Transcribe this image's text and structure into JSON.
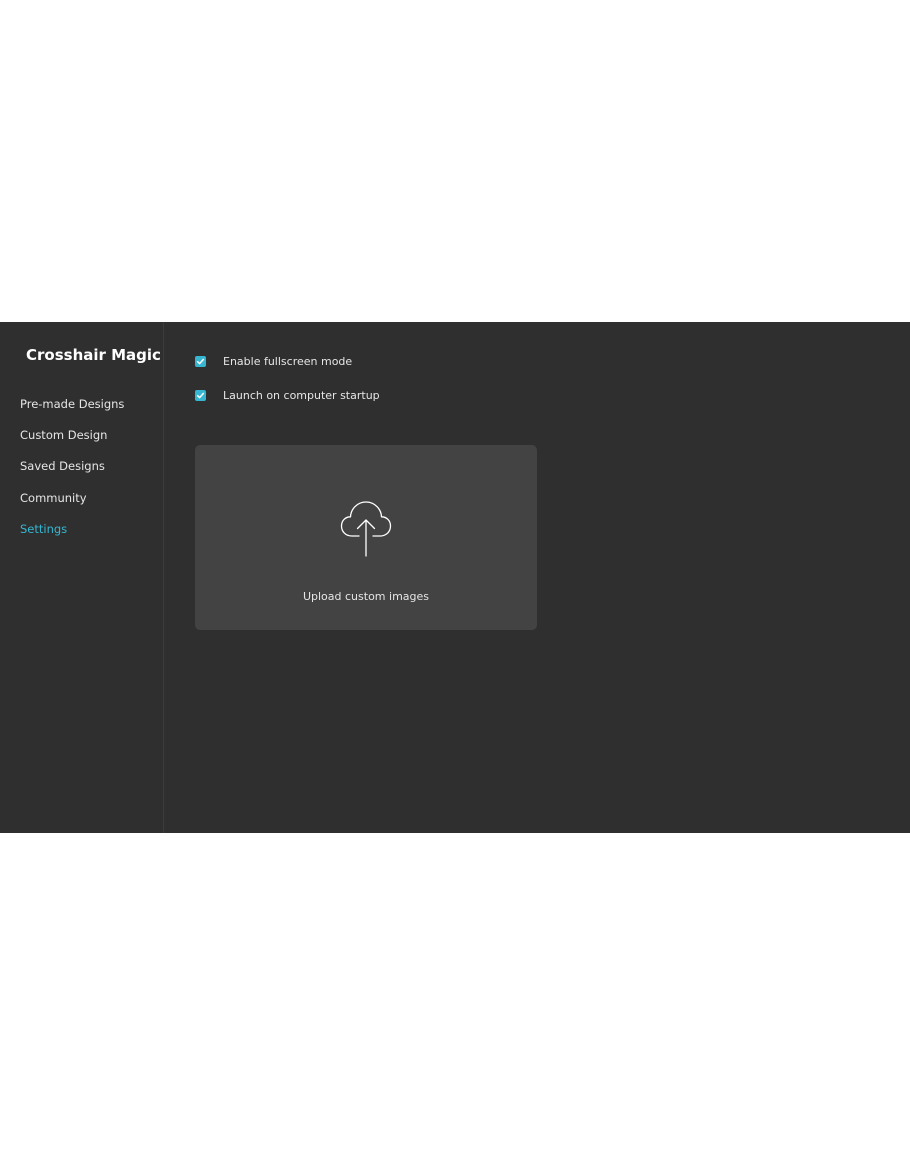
{
  "app": {
    "title": "Crosshair Magic"
  },
  "sidebar": {
    "items": [
      {
        "label": "Pre-made Designs"
      },
      {
        "label": "Custom Design"
      },
      {
        "label": "Saved Designs"
      },
      {
        "label": "Community"
      },
      {
        "label": "Settings",
        "active": true
      }
    ]
  },
  "settings": {
    "options": [
      {
        "label": "Enable fullscreen mode",
        "checked": true
      },
      {
        "label": "Launch on computer startup",
        "checked": true
      }
    ],
    "upload": {
      "label": "Upload custom images",
      "icon": "cloud-upload-icon"
    }
  },
  "colors": {
    "accent": "#36b6d1",
    "background": "#2f2f2f",
    "card": "#434343",
    "text": "#e6e6e6"
  }
}
